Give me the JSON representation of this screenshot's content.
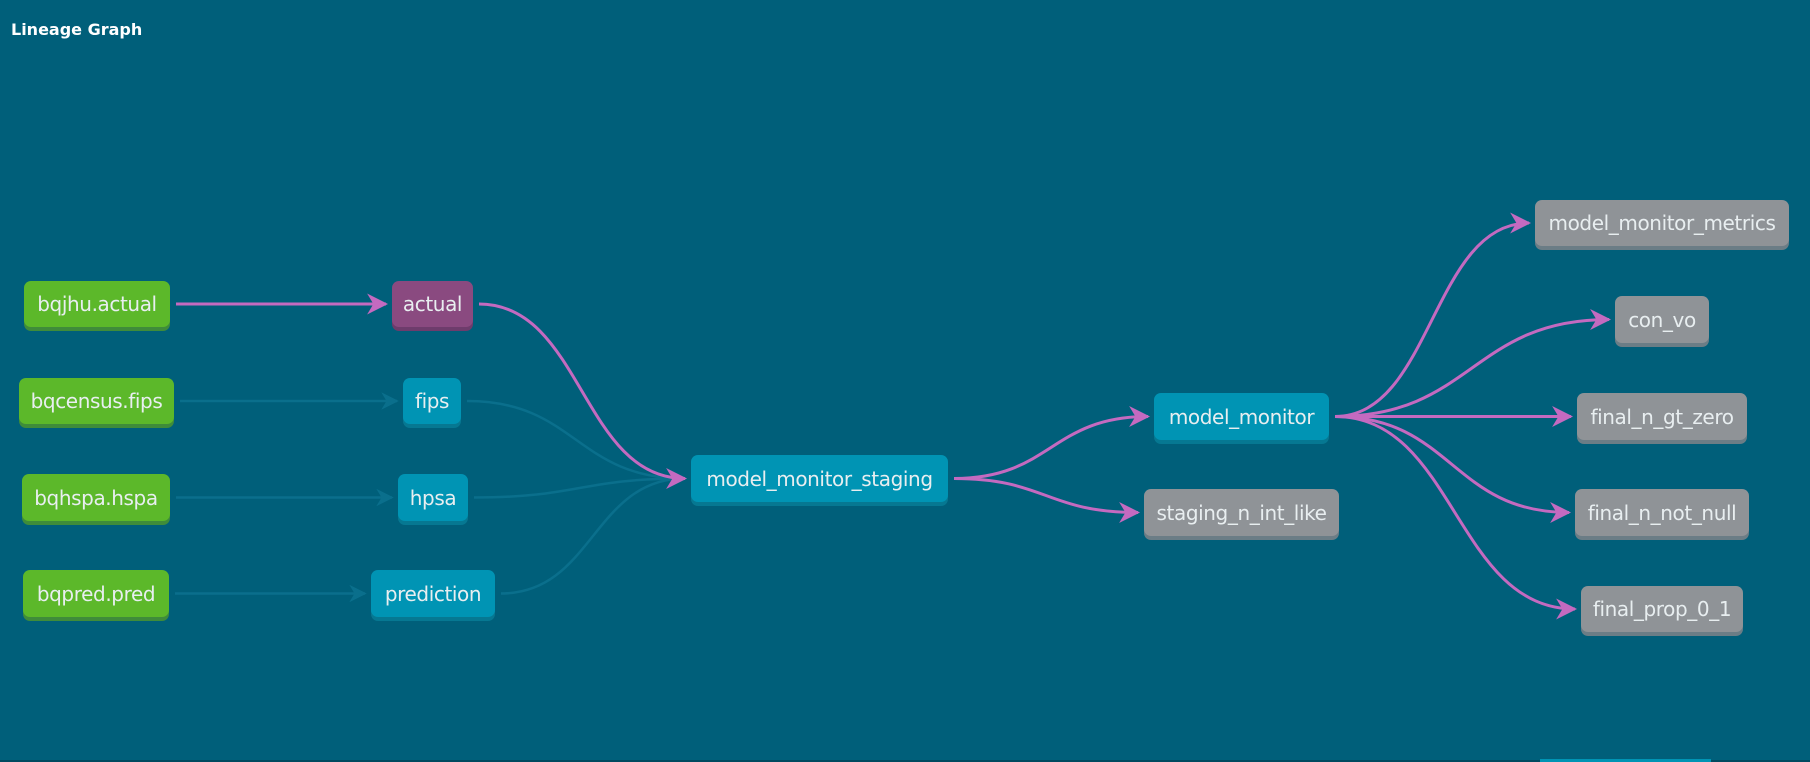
{
  "header": {
    "title": "Lineage Graph"
  },
  "colors": {
    "background": "#005f7a",
    "source_node": "#5cb82a",
    "model_node": "#0094b4",
    "selected_node": "#8a4a80",
    "test_node": "#8f9397",
    "highlight_edge": "#c46ac0",
    "dim_edge": "#0a6f8c"
  },
  "nodes": [
    {
      "id": "bqjhu_actual",
      "label": "bqjhu.actual",
      "kind": "source"
    },
    {
      "id": "bqcensus_fips",
      "label": "bqcensus.fips",
      "kind": "source"
    },
    {
      "id": "bqhspa_hspa",
      "label": "bqhspa.hspa",
      "kind": "source"
    },
    {
      "id": "bqpred_pred",
      "label": "bqpred.pred",
      "kind": "source"
    },
    {
      "id": "actual",
      "label": "actual",
      "kind": "selected"
    },
    {
      "id": "fips",
      "label": "fips",
      "kind": "model"
    },
    {
      "id": "hpsa",
      "label": "hpsa",
      "kind": "model"
    },
    {
      "id": "prediction",
      "label": "prediction",
      "kind": "model"
    },
    {
      "id": "model_monitor_staging",
      "label": "model_monitor_staging",
      "kind": "model"
    },
    {
      "id": "model_monitor",
      "label": "model_monitor",
      "kind": "model"
    },
    {
      "id": "staging_n_int_like",
      "label": "staging_n_int_like",
      "kind": "test"
    },
    {
      "id": "model_monitor_metrics",
      "label": "model_monitor_metrics",
      "kind": "test"
    },
    {
      "id": "con_vo",
      "label": "con_vo",
      "kind": "test"
    },
    {
      "id": "final_n_gt_zero",
      "label": "final_n_gt_zero",
      "kind": "test"
    },
    {
      "id": "final_n_not_null",
      "label": "final_n_not_null",
      "kind": "test"
    },
    {
      "id": "final_prop_0_1",
      "label": "final_prop_0_1",
      "kind": "test"
    }
  ],
  "edges": [
    {
      "from": "bqjhu_actual",
      "to": "actual",
      "highlighted": true
    },
    {
      "from": "bqcensus_fips",
      "to": "fips",
      "highlighted": false
    },
    {
      "from": "bqhspa_hspa",
      "to": "hpsa",
      "highlighted": false
    },
    {
      "from": "bqpred_pred",
      "to": "prediction",
      "highlighted": false
    },
    {
      "from": "actual",
      "to": "model_monitor_staging",
      "highlighted": true
    },
    {
      "from": "fips",
      "to": "model_monitor_staging",
      "highlighted": false
    },
    {
      "from": "hpsa",
      "to": "model_monitor_staging",
      "highlighted": false
    },
    {
      "from": "prediction",
      "to": "model_monitor_staging",
      "highlighted": false
    },
    {
      "from": "model_monitor_staging",
      "to": "model_monitor",
      "highlighted": true
    },
    {
      "from": "model_monitor_staging",
      "to": "staging_n_int_like",
      "highlighted": true
    },
    {
      "from": "model_monitor",
      "to": "model_monitor_metrics",
      "highlighted": true
    },
    {
      "from": "model_monitor",
      "to": "con_vo",
      "highlighted": true
    },
    {
      "from": "model_monitor",
      "to": "final_n_gt_zero",
      "highlighted": true
    },
    {
      "from": "model_monitor",
      "to": "final_n_not_null",
      "highlighted": true
    },
    {
      "from": "model_monitor",
      "to": "final_prop_0_1",
      "highlighted": true
    }
  ]
}
